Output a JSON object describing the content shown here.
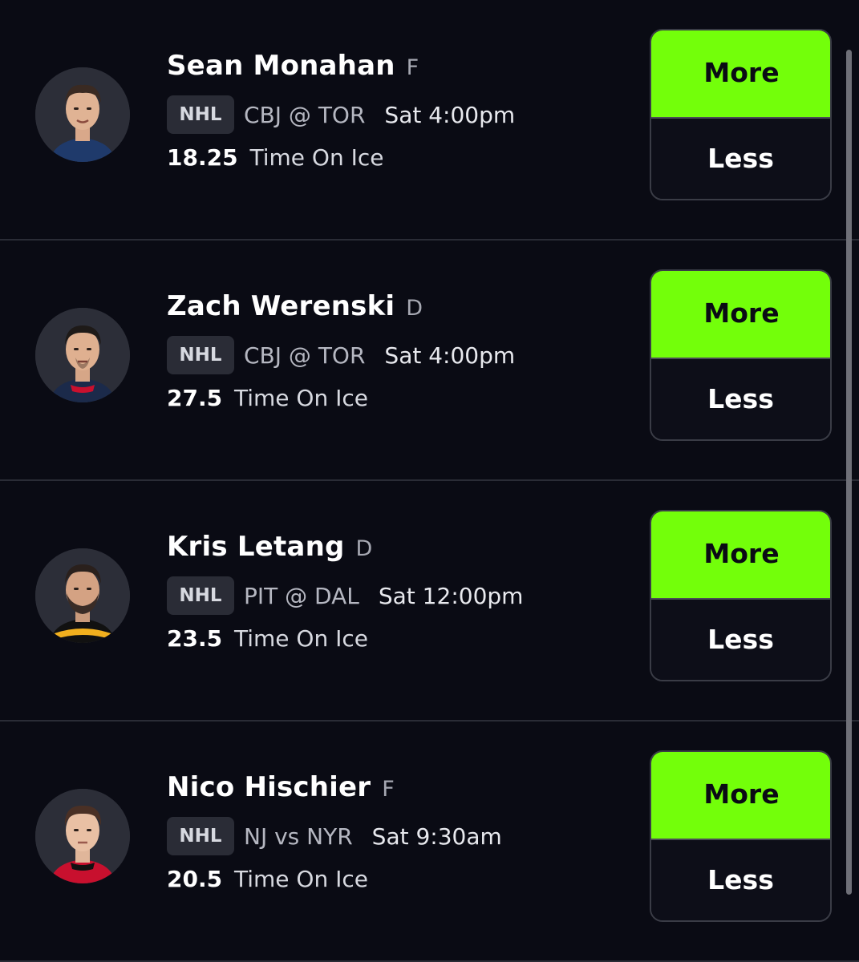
{
  "picks": [
    {
      "name": "Sean Monahan",
      "position": "F",
      "league": "NHL",
      "matchup": "CBJ @ TOR",
      "game_time": "Sat 4:00pm",
      "stat_value": "18.25",
      "stat_label": "Time On Ice",
      "more_label": "More",
      "less_label": "Less",
      "jersey_color": "#1f3a6b"
    },
    {
      "name": "Zach Werenski",
      "position": "D",
      "league": "NHL",
      "matchup": "CBJ @ TOR",
      "game_time": "Sat 4:00pm",
      "stat_value": "27.5",
      "stat_label": "Time On Ice",
      "more_label": "More",
      "less_label": "Less",
      "jersey_color": "#1b2a4a"
    },
    {
      "name": "Kris Letang",
      "position": "D",
      "league": "NHL",
      "matchup": "PIT @ DAL",
      "game_time": "Sat 12:00pm",
      "stat_value": "23.5",
      "stat_label": "Time On Ice",
      "more_label": "More",
      "less_label": "Less",
      "jersey_color": "#f2b01e"
    },
    {
      "name": "Nico Hischier",
      "position": "F",
      "league": "NHL",
      "matchup": "NJ vs NYR",
      "game_time": "Sat 9:30am",
      "stat_value": "20.5",
      "stat_label": "Time On Ice",
      "more_label": "More",
      "less_label": "Less",
      "jersey_color": "#c8102e"
    }
  ],
  "colors": {
    "background": "#0a0b14",
    "more_button": "#73ff0a",
    "badge": "#2a2c36"
  },
  "icons": {
    "avatar": "player-headshot"
  }
}
